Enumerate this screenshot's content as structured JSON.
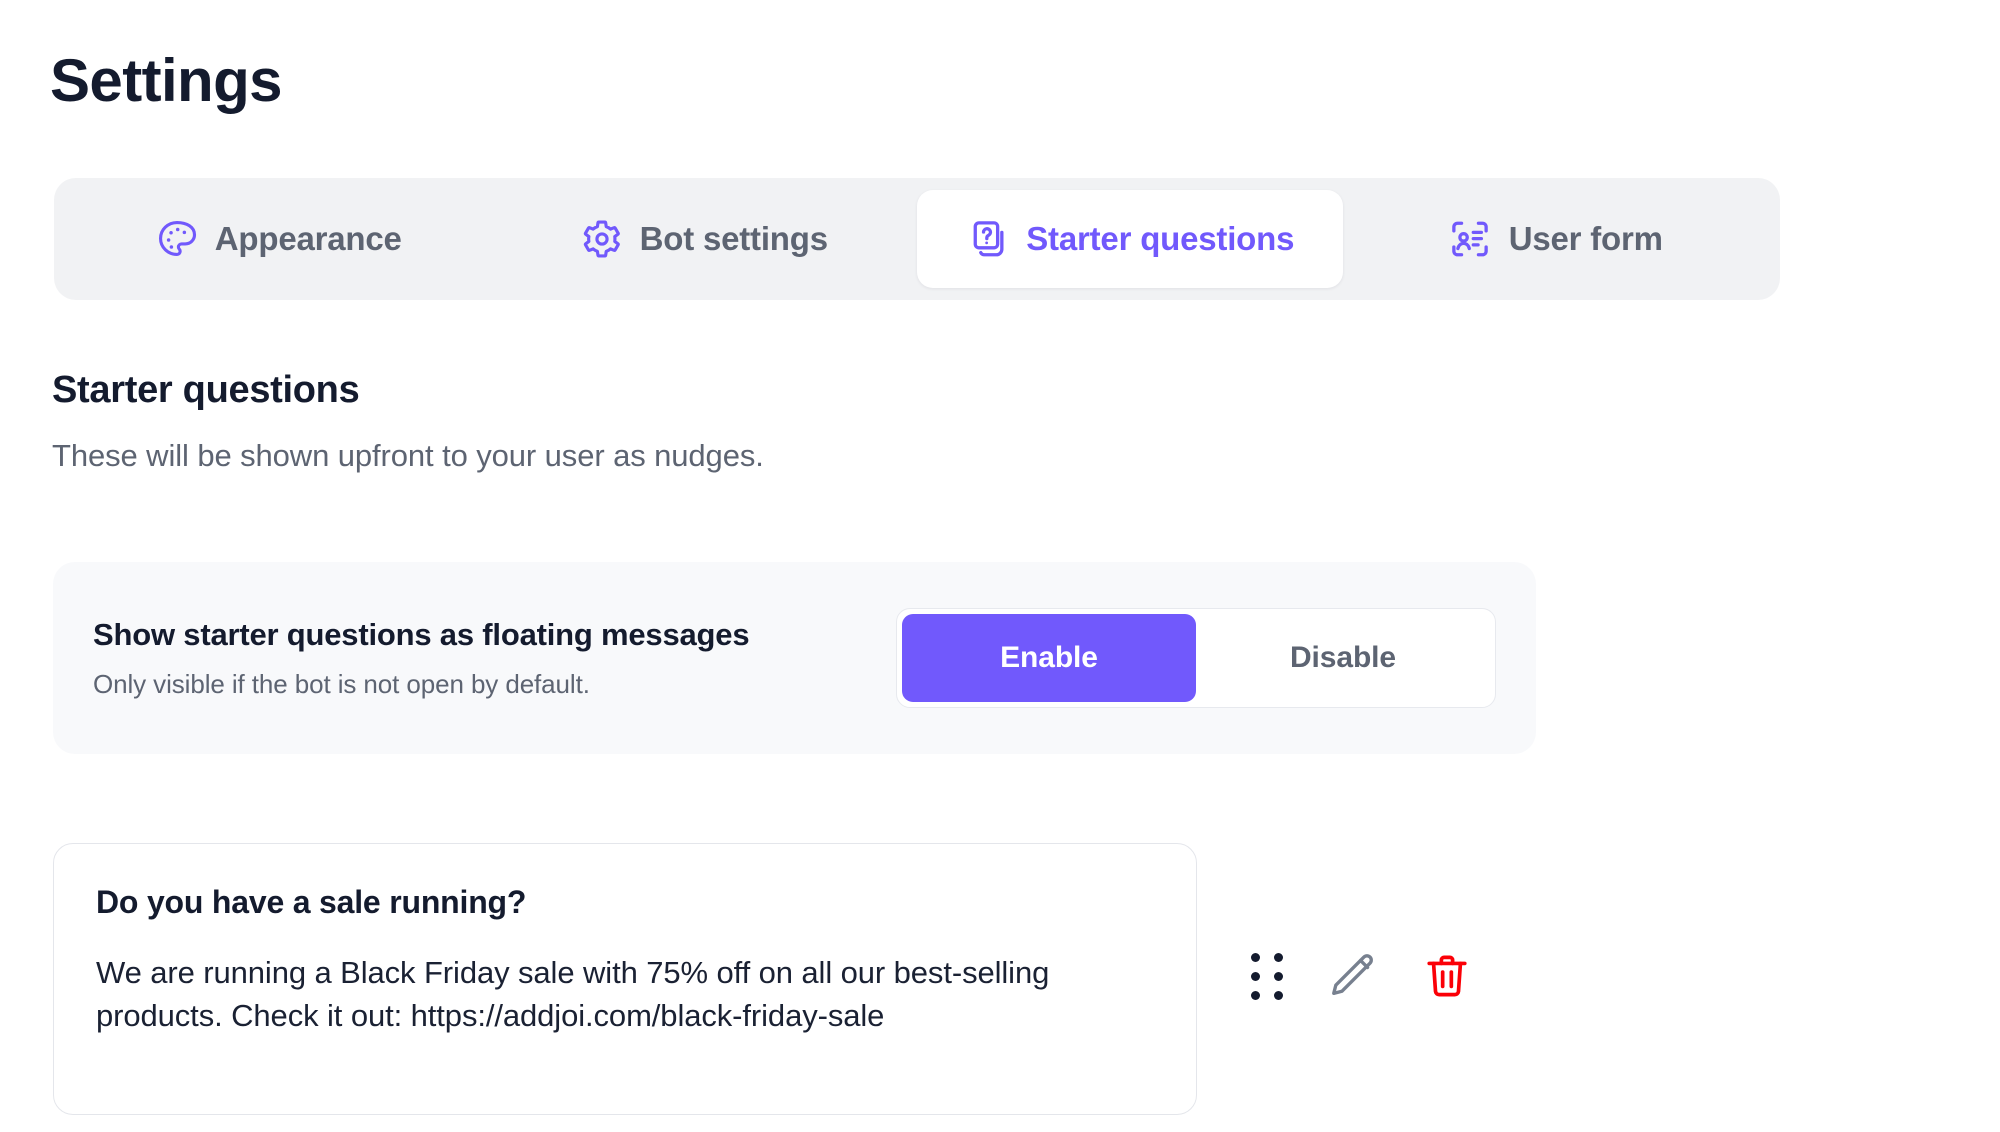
{
  "page": {
    "title": "Settings"
  },
  "tabs": [
    {
      "label": "Appearance",
      "icon": "palette-icon",
      "active": false
    },
    {
      "label": "Bot settings",
      "icon": "gear-icon",
      "active": false
    },
    {
      "label": "Starter questions",
      "icon": "question-cards-icon",
      "active": true
    },
    {
      "label": "User form",
      "icon": "user-card-icon",
      "active": false
    }
  ],
  "section": {
    "title": "Starter questions",
    "subtitle": "These will be shown upfront to your user as nudges."
  },
  "floating_setting": {
    "title": "Show starter questions as floating messages",
    "subtitle": "Only visible if the bot is not open by default.",
    "options": [
      "Enable",
      "Disable"
    ],
    "selected": "Enable"
  },
  "questions": [
    {
      "title": "Do you have a sale running?",
      "answer": "We are running a Black Friday sale with 75% off on all our best-selling products. Check it out: https://addjoi.com/black-friday-sale",
      "actions": [
        "drag-handle-icon",
        "edit-icon",
        "delete-icon"
      ]
    }
  ],
  "colors": {
    "accent": "#7159FC",
    "title_text": "#141B2E",
    "muted_text": "#5D6472",
    "tabbar_bg": "#F1F2F4",
    "panel_bg": "#F8F9FB",
    "card_border": "#E4E6EB",
    "danger": "#FB0007",
    "edit_icon": "#77808F"
  }
}
